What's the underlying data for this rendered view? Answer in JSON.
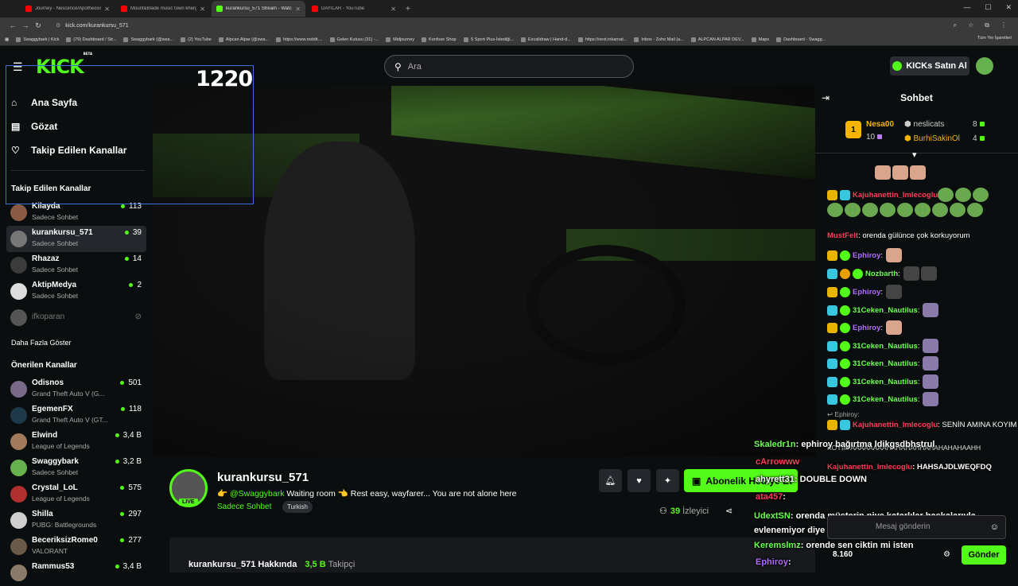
{
  "browser": {
    "tabs": [
      {
        "title": "Journey - Nescence/Apotheosis"
      },
      {
        "title": "Mount&Blade music town khergit"
      },
      {
        "title": "kurankursu_571 Stream - Watch"
      },
      {
        "title": "DAYILAR - YouTube"
      }
    ],
    "url": "kick.com/kurankursu_571",
    "bookmarks": [
      "Swaggybark | Kick",
      "(79) Dashboard / Str...",
      "Swaggybark (@swa...",
      "(2) YouTube",
      "Alpcan Alpar (@swa...",
      "https://www.reddit....",
      "Gelen Kutusu (31) -...",
      "Midjourney",
      "Konfuse Shop",
      "S Sport Plus-İstediği...",
      "Excalidraw | Hand-d...",
      "https://next.inkarnat...",
      "Inbox - Zoho Mail (a...",
      "ALPCAN ALPAR DEV...",
      "Maps",
      "Dashboard - Swagg..."
    ],
    "bookmarks_right": "Tüm Yer İşaretleri"
  },
  "topbar": {
    "logo": "KICK",
    "logo_sup": "BETA",
    "search_placeholder": "Ara",
    "buy_kicks": "KICKs Satın Al"
  },
  "overlay_counter": "1220",
  "sidebar": {
    "nav": [
      {
        "label": "Ana Sayfa",
        "icon": "home-icon"
      },
      {
        "label": "Gözat",
        "icon": "browse-icon"
      },
      {
        "label": "Takip Edilen Kanallar",
        "icon": "heart-icon"
      }
    ],
    "followed_title": "Takip Edilen Kanallar",
    "followed": [
      {
        "name": "Kilayda",
        "sub": "Sadece Sohbet",
        "viewers": "113"
      },
      {
        "name": "kurankursu_571",
        "sub": "Sadece Sohbet",
        "viewers": "39"
      },
      {
        "name": "Rhazaz",
        "sub": "Sadece Sohbet",
        "viewers": "14"
      },
      {
        "name": "AktipMedya",
        "sub": "Sadece Sohbet",
        "viewers": "2"
      },
      {
        "name": "ifkoparan",
        "sub": "",
        "viewers": ""
      }
    ],
    "show_more": "Daha Fazla Göster",
    "recommended_title": "Önerilen Kanallar",
    "recommended": [
      {
        "name": "Odisnos",
        "sub": "Grand Theft Auto V (G...",
        "viewers": "501"
      },
      {
        "name": "EgemenFX",
        "sub": "Grand Theft Auto V (GT...",
        "viewers": "118"
      },
      {
        "name": "Elwind",
        "sub": "League of Legends",
        "viewers": "3,4 B"
      },
      {
        "name": "Swaggybark",
        "sub": "Sadece Sohbet",
        "viewers": "3,2 B"
      },
      {
        "name": "Crystal_LoL",
        "sub": "League of Legends",
        "viewers": "575"
      },
      {
        "name": "Shilla",
        "sub": "PUBG: Battlegrounds",
        "viewers": "297"
      },
      {
        "name": "BeceriksizRome0",
        "sub": "VALORANT",
        "viewers": "277"
      },
      {
        "name": "Rammus53",
        "sub": "",
        "viewers": "3,4 B"
      }
    ]
  },
  "stream": {
    "name": "kurankursu_571",
    "live": "LIVE",
    "title_prefix": "👉",
    "mention": "@Swaggybark",
    "title_rest": "Waiting room 👈 Rest easy, wayfarer... You are not alone here",
    "category": "Sadece Sohbet",
    "tag": "Turkish",
    "subscribe": "Abonelik Hediye Et",
    "viewers": "39",
    "viewers_label": "İzleyici",
    "about_title": "kurankursu_571 Hakkında",
    "followers": "3,5 B",
    "followers_label": "Takipçi"
  },
  "chat": {
    "title": "Sohbet",
    "leaderboard": [
      {
        "name": "Nesa00",
        "points": "10"
      },
      {
        "name": "neslicats",
        "points": "8"
      },
      {
        "name": "BurhiSakinOl",
        "points": "4"
      }
    ],
    "messages": [
      {
        "user": "Kajuhanettin_Imlecoglu",
        "text": ""
      },
      {
        "user": "MustFelt",
        "text": ": orenda gülünce çok korkuyorum"
      },
      {
        "user": "Ephiroy",
        "text": ":"
      },
      {
        "user": "Nozbarth",
        "text": ":"
      },
      {
        "user": "Ephiroy",
        "text": ":"
      },
      {
        "user": "31Ceken_Nautilus",
        "text": ":"
      },
      {
        "user": "Ephiroy",
        "text": ":"
      },
      {
        "user": "31Ceken_Nautilus",
        "text": ":"
      },
      {
        "user": "31Ceken_Nautilus",
        "text": ":"
      },
      {
        "user": "31Ceken_Nautilus",
        "text": ":"
      },
      {
        "user": "31Ceken_Nautilus",
        "text": ":"
      }
    ],
    "reply_to": "Ephiroy:",
    "reply_user": "Kajuhanettin_Imlecoglu",
    "reply_text": ": SENİN AMINA KOYIM",
    "overlay": [
      {
        "user": "Skaledr1n",
        "text": ": ephiroy bağırtma ldikgsdbhstrul"
      },
      {
        "user": "cArrowww",
        "text": ""
      },
      {
        "user": "Kajuhanettin_Imlecoglu",
        "text": ": HAHSAJDLWEQFDQ"
      },
      {
        "user": "ahyrett31",
        "text": ": DOUBLE DOWN"
      },
      {
        "user": "ata457",
        "text": ":"
      },
      {
        "user": "UdextSN",
        "text": ": orenda müşterin niye katarlılar başkalarıyla evlenemiyor diye info veriyo"
      },
      {
        "user": "Keremslmz",
        "text": ": orende sen ciktin mi isten"
      },
      {
        "user": "Ephiroy",
        "text": ":"
      }
    ],
    "laugh_line": "KOYIM AAAAAAAAHAHAHAHHAHAHAHAHAAHH",
    "input_placeholder": "Mesaj gönderin",
    "points": "8.160",
    "send": "Gönder"
  },
  "colors": {
    "accent": "#53fc18",
    "background": "#0b0e0f",
    "highlight_border": "#3d6fd6"
  }
}
